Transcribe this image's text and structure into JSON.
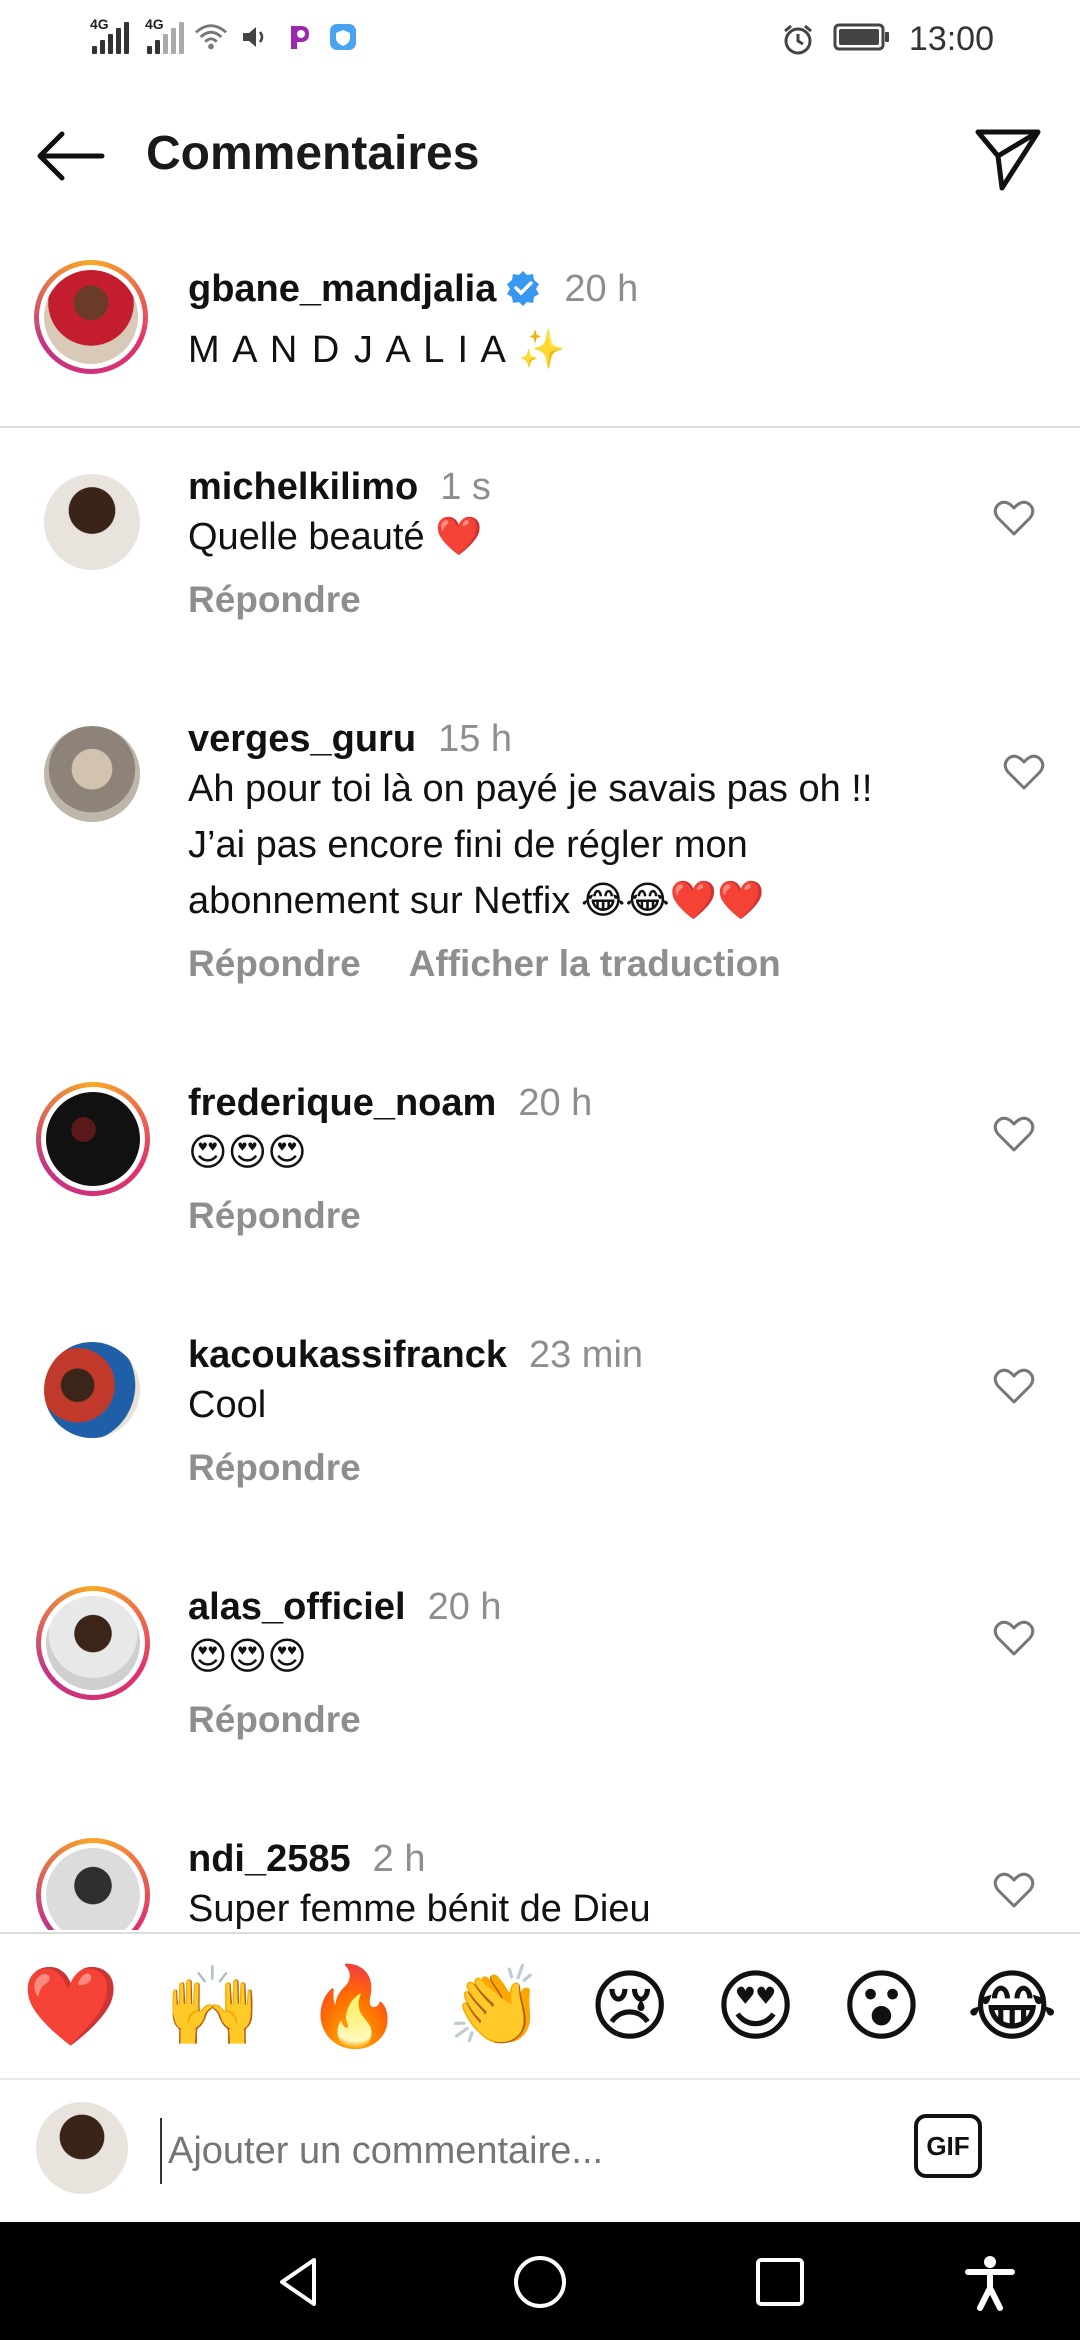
{
  "status_bar": {
    "network1": "4G",
    "network2": "4G",
    "time": "13:00"
  },
  "header": {
    "title": "Commentaires"
  },
  "caption": {
    "username": "gbane_mandjalia",
    "time": "20 h",
    "text": "M A N D J A L I A ✨"
  },
  "comments": [
    {
      "username": "michelkilimo",
      "time": "1 s",
      "lines": [
        "Quelle beauté ❤️"
      ],
      "reply": "Répondre",
      "translate": ""
    },
    {
      "username": "verges_guru",
      "time": "15 h",
      "lines": [
        "Ah pour toi là on payé je savais pas oh !!",
        "J’ai pas encore fini de régler mon",
        "abonnement sur Netfix 😂😂❤️❤️"
      ],
      "reply": "Répondre",
      "translate": "Afficher la traduction"
    },
    {
      "username": "frederique_noam",
      "time": "20 h",
      "lines": [
        "😍😍😍"
      ],
      "reply": "Répondre",
      "translate": ""
    },
    {
      "username": "kacoukassifranck",
      "time": "23 min",
      "lines": [
        "Cool"
      ],
      "reply": "Répondre",
      "translate": ""
    },
    {
      "username": "alas_officiel",
      "time": "20 h",
      "lines": [
        "😍😍😍"
      ],
      "reply": "Répondre",
      "translate": ""
    },
    {
      "username": "ndi_2585",
      "time": "2 h",
      "lines": [
        "Super femme bénit de Dieu"
      ],
      "reply": "",
      "translate": ""
    }
  ],
  "emoji_bar": [
    "❤️",
    "🙌",
    "🔥",
    "👏",
    "😢",
    "😍",
    "😮",
    "😂"
  ],
  "input": {
    "placeholder": "Ajouter un commentaire...",
    "gif_label": "GIF"
  },
  "colors": {
    "verified": "#3897f0",
    "secondary_text": "#8e8e8e",
    "story_ring": "#e1306c"
  },
  "icons": [
    "back-arrow-icon",
    "send-icon",
    "heart-icon",
    "verified-icon",
    "nav-back-icon",
    "nav-home-icon",
    "nav-recents-icon",
    "accessibility-icon"
  ]
}
